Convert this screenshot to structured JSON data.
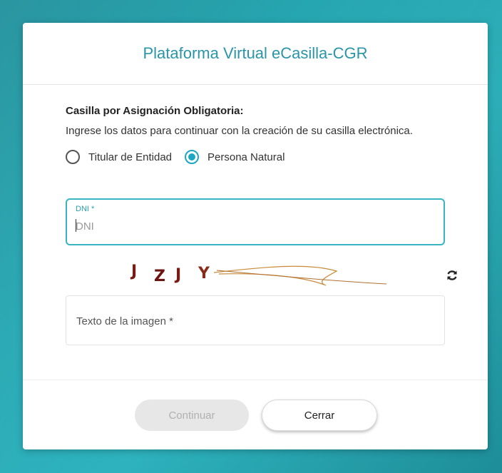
{
  "dialog": {
    "title": "Plataforma Virtual eCasilla-CGR"
  },
  "section": {
    "title": "Casilla por Asignación Obligatoria:",
    "description": "Ingrese los datos para continuar con la creación de su casilla electrónica."
  },
  "radio_options": [
    {
      "label": "Titular de Entidad",
      "checked": false
    },
    {
      "label": "Persona Natural",
      "checked": true
    }
  ],
  "dni_field": {
    "label": "DNI *",
    "placeholder": "DNI",
    "value": ""
  },
  "captcha": {
    "text": "JZJY",
    "refresh_icon": "refresh-icon"
  },
  "captcha_field": {
    "placeholder": "Texto de la imagen *",
    "value": ""
  },
  "buttons": {
    "continue_label": "Continuar",
    "close_label": "Cerrar"
  },
  "colors": {
    "accent": "#1ea7c2",
    "title": "#2a95a6",
    "background": "#27a8b3",
    "captcha_text": "#7a1a14"
  }
}
